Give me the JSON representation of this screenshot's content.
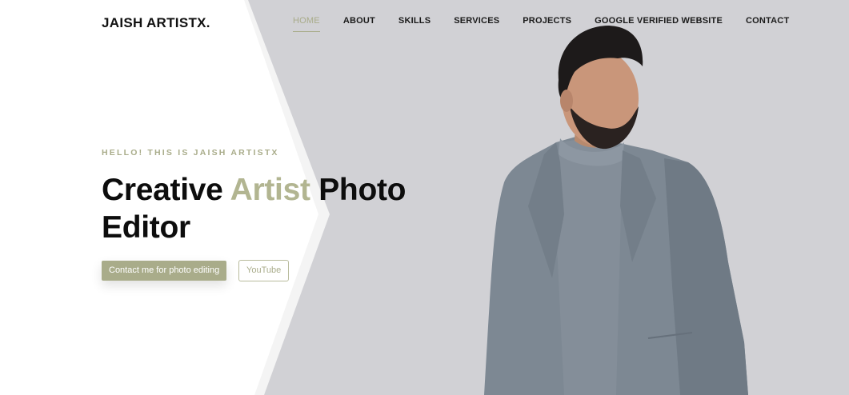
{
  "header": {
    "logo": "JAISH ARTISTX.",
    "nav": [
      {
        "label": "HOME",
        "active": true
      },
      {
        "label": "ABOUT",
        "active": false
      },
      {
        "label": "SKILLS",
        "active": false
      },
      {
        "label": "SERVICES",
        "active": false
      },
      {
        "label": "PROJECTS",
        "active": false
      },
      {
        "label": "GOOGLE VERIFIED WEBSITE",
        "active": false
      },
      {
        "label": "CONTACT",
        "active": false
      }
    ]
  },
  "hero": {
    "eyebrow": "HELLO! THIS IS JAISH ARTISTX",
    "title_part1": "Creative ",
    "title_accent": "Artist",
    "title_part2": " Photo",
    "title_line2": "Editor",
    "primary_button": "Contact me for photo editing",
    "secondary_button": "YouTube",
    "image": "portrait-photo"
  },
  "colors": {
    "accent": "#a9ac8a",
    "background_right": "#d1d1d5",
    "background_left": "#ffffff",
    "text": "#0d0d0d"
  }
}
